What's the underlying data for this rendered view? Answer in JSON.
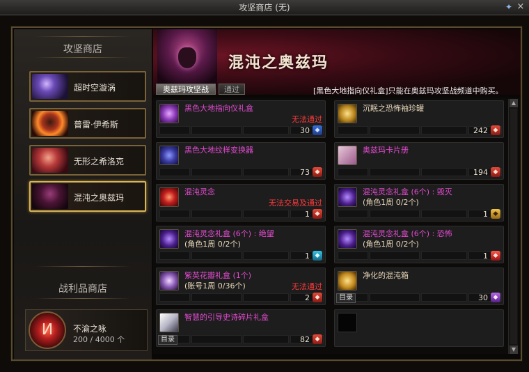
{
  "window": {
    "title": "攻坚商店 (无)"
  },
  "sidebar": {
    "title": "攻坚商店",
    "shops": [
      {
        "label": "超时空漩涡"
      },
      {
        "label": "普雷·伊希斯"
      },
      {
        "label": "无形之希洛克"
      },
      {
        "label": "混沌之奥兹玛"
      }
    ],
    "loot_title": "战利品商店",
    "loot": {
      "name": "不渝之咏",
      "count": "200 / 4000 个"
    }
  },
  "banner": {
    "title": "混沌之奥兹玛"
  },
  "tabs": [
    {
      "label": "奥兹玛攻坚战"
    },
    {
      "label": "通过"
    }
  ],
  "notice": "[黑色大地指向仪礼盒]只能在奥兹玛攻坚战频道中购买。",
  "catalog_label": "目录",
  "items": [
    {
      "name": "黑色大地指向仪礼盒",
      "sub": "",
      "warn": "无法通过",
      "price": "30",
      "currency": "blue",
      "color": "pink"
    },
    {
      "name": "沉眠之恐怖袖珍罐",
      "sub": "",
      "warn": "",
      "price": "242",
      "currency": "red",
      "color": "gold"
    },
    {
      "name": "黑色大地纹样变换器",
      "sub": "",
      "warn": "",
      "price": "73",
      "currency": "red",
      "color": "pink"
    },
    {
      "name": "奥兹玛卡片册",
      "sub": "",
      "warn": "",
      "price": "194",
      "currency": "red",
      "color": "pink"
    },
    {
      "name": "混沌灵念",
      "sub": "",
      "warn": "无法交易及通过",
      "price": "1",
      "currency": "red",
      "color": "pink"
    },
    {
      "name": "混沌灵念礼盒 (6个) : 毁灭",
      "sub": "(角色1周 0/2个)",
      "warn": "",
      "price": "1",
      "currency": "gold",
      "color": "pink"
    },
    {
      "name": "混沌灵念礼盒 (6个) : 绝望",
      "sub": "(角色1周 0/2个)",
      "warn": "",
      "price": "1",
      "currency": "cyan",
      "color": "pink"
    },
    {
      "name": "混沌灵念礼盒 (6个) : 恐怖",
      "sub": "(角色1周 0/2个)",
      "warn": "",
      "price": "1",
      "currency": "mask",
      "color": "pink"
    },
    {
      "name": "紫英花瓣礼盒 (1个)",
      "sub": "(账号1周 0/36个)",
      "warn": "无法通过",
      "price": "2",
      "currency": "red",
      "color": "pink"
    },
    {
      "name": "净化的混沌箱",
      "sub": "",
      "warn": "",
      "price": "30",
      "currency": "purple",
      "color": "gold",
      "catalog": true
    },
    {
      "name": "智慧的引导史诗碎片礼盒",
      "sub": "",
      "warn": "",
      "price": "82",
      "currency": "red",
      "color": "pink",
      "catalog": true
    }
  ]
}
